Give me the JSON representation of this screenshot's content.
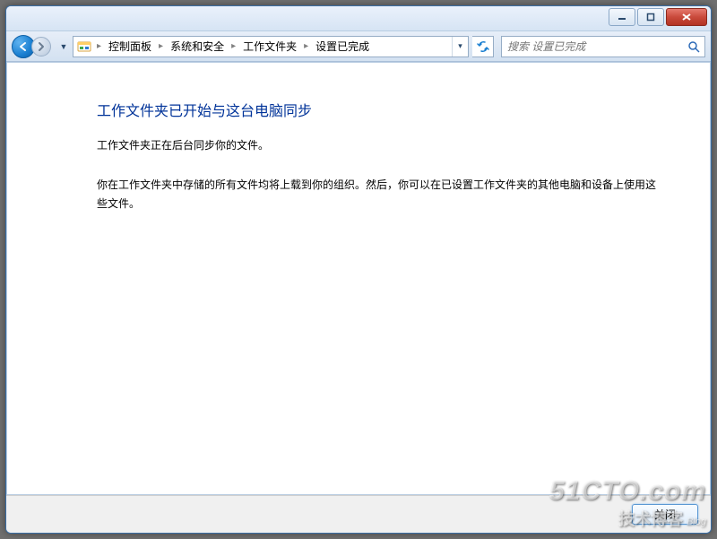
{
  "breadcrumb": {
    "items": [
      "控制面板",
      "系统和安全",
      "工作文件夹",
      "设置已完成"
    ]
  },
  "search": {
    "placeholder": "搜索 设置已完成"
  },
  "main": {
    "heading": "工作文件夹已开始与这台电脑同步",
    "line1": "工作文件夹正在后台同步你的文件。",
    "line2": "你在工作文件夹中存储的所有文件均将上载到你的组织。然后，你可以在已设置工作文件夹的其他电脑和设备上使用这些文件。"
  },
  "buttons": {
    "close": "关闭"
  },
  "watermark": {
    "line1": "51CTO.com",
    "line2": "技术博客",
    "blog": "Blog"
  }
}
